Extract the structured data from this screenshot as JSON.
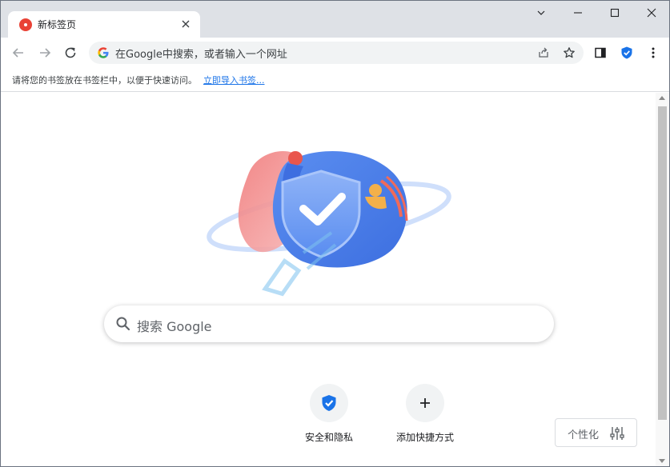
{
  "window": {
    "tab_title": "新标签页",
    "tab_favicon": "new-tab-favicon",
    "controls": [
      "chevron-down-icon",
      "minimize-icon",
      "maximize-icon",
      "close-icon"
    ]
  },
  "toolbar": {
    "omnibox_placeholder": "在Google中搜索，或者输入一个网址",
    "icons": [
      "back-icon",
      "forward-icon",
      "reload-icon",
      "share-icon",
      "star-icon",
      "side-panel-icon",
      "shield-extension-icon",
      "menu-icon"
    ]
  },
  "bookmark_bar": {
    "message": "请将您的书签放在书签栏中，以便于快速访问。",
    "import_link": "立即导入书签..."
  },
  "search": {
    "placeholder": "搜索 Google"
  },
  "shortcuts": [
    {
      "label": "安全和隐私",
      "icon": "shield-check-icon"
    },
    {
      "label": "添加快捷方式",
      "icon": "plus-icon"
    }
  ],
  "customize": {
    "label": "个性化",
    "icon": "sliders-icon"
  },
  "colors": {
    "tabstrip": "#dee1e6",
    "link": "#1a73e8",
    "shield_blue": "#1a73e8",
    "omnibox": "#f1f3f4"
  }
}
